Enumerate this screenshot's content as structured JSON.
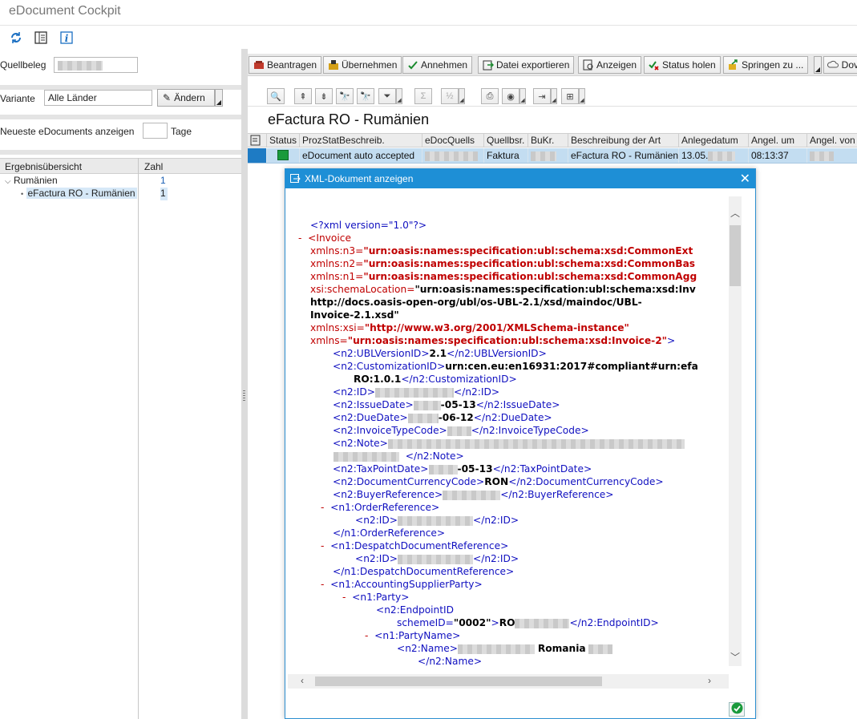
{
  "window": {
    "title": "eDocument Cockpit"
  },
  "app_toolbar": {
    "icons": [
      "refresh-icon",
      "layout-icon",
      "info-icon"
    ]
  },
  "selection": {
    "quellbeleg_label": "Quellbeleg",
    "variante_label": "Variante",
    "variante_value": "Alle Länder",
    "aendern_label": "Ändern",
    "neueste_label": "Neueste eDocuments anzeigen",
    "tage_label": "Tage"
  },
  "tree": {
    "col1": "Ergebnisübersicht",
    "col2": "Zahl",
    "rows": [
      {
        "label": "Rumänien",
        "count": "1"
      },
      {
        "label": "eFactura RO - Rumänien",
        "count": "1"
      }
    ]
  },
  "toolbar": {
    "beantragen": "Beantragen",
    "uebernehmen": "Übernehmen",
    "annehmen": "Annehmen",
    "datei_exportieren": "Datei exportieren",
    "anzeigen": "Anzeigen",
    "status_holen": "Status holen",
    "springen_zu": "Springen zu ...",
    "dov": "Dov"
  },
  "grid": {
    "title": "eFactura RO - Rumänien",
    "columns": [
      "Status",
      "ProzStatBeschreib.",
      "eDocQuells",
      "Quellbsr.",
      "BuKr.",
      "Beschreibung der Art",
      "Anlegedatum",
      "Angel. um",
      "Angel. von"
    ],
    "row": {
      "status_color": "#1a9a3c",
      "prozstat": "eDocument auto accepted",
      "quellbsr": "Faktura",
      "beschreibung": "eFactura RO - Rumänien",
      "anlegedatum": "13.05.",
      "angel_um": "08:13:37"
    }
  },
  "dialog": {
    "title": "XML-Dokument anzeigen",
    "close": "✕",
    "xml": {
      "decl": "<?xml version=\"1.0\"?>",
      "invoice_open": "<Invoice",
      "ns3_attr": "xmlns:n3=",
      "ns3_val": "\"urn:oasis:names:specification:ubl:schema:xsd:CommonExt",
      "ns2_attr": "xmlns:n2=",
      "ns2_val": "\"urn:oasis:names:specification:ubl:schema:xsd:CommonBas",
      "ns1_attr": "xmlns:n1=",
      "ns1_val": "\"urn:oasis:names:specification:ubl:schema:xsd:CommonAgg",
      "schemaloc_attr": "xsi:schemaLocation=",
      "schemaloc_val1": "\"urn:oasis:names:specification:ubl:schema:xsd:Inv",
      "schemaloc_val2": "http://docs.oasis-open-org/ubl/os-UBL-2.1/xsd/maindoc/UBL-",
      "schemaloc_val3": "Invoice-2.1.xsd\"",
      "xsi_attr": "xmlns:xsi=",
      "xsi_val": "\"http://www.w3.org/2001/XMLSchema-instance\"",
      "xmlns_attr": "xmlns=",
      "xmlns_val": "\"urn:oasis:names:specification:ubl:schema:xsd:Invoice-2\"",
      "xmlns_close": ">",
      "ubl_open": "<n2:UBLVersionID>",
      "ubl_val": "2.1",
      "ubl_close": "</n2:UBLVersionID>",
      "cust_open": "<n2:CustomizationID>",
      "cust_val1": "urn:cen.eu:en16931:2017#compliant#urn:efa",
      "cust_val2": "RO:1.0.1",
      "cust_close": "</n2:CustomizationID>",
      "id_open": "<n2:ID>",
      "id_close": "</n2:ID>",
      "issue_open": "<n2:IssueDate>",
      "issue_val": "-05-13",
      "issue_close": "</n2:IssueDate>",
      "due_open": "<n2:DueDate>",
      "due_val": "-06-12",
      "due_close": "</n2:DueDate>",
      "itc_open": "<n2:InvoiceTypeCode>",
      "itc_close": "</n2:InvoiceTypeCode>",
      "note_open": "<n2:Note>",
      "note_close": "</n2:Note>",
      "tpd_open": "<n2:TaxPointDate>",
      "tpd_val": "-05-13",
      "tpd_close": "</n2:TaxPointDate>",
      "dcc_open": "<n2:DocumentCurrencyCode>",
      "dcc_val": "RON",
      "dcc_close": "</n2:DocumentCurrencyCode>",
      "buyer_open": "<n2:BuyerReference>",
      "buyer_close": "</n2:BuyerReference>",
      "order_open": "<n1:OrderReference>",
      "order_close": "</n1:OrderReference>",
      "despatch_open": "<n1:DespatchDocumentReference>",
      "despatch_close": "</n1:DespatchDocumentReference>",
      "asp_open": "<n1:AccountingSupplierParty>",
      "party_open": "<n1:Party>",
      "endpoint_open": "<n2:EndpointID",
      "scheme_attr": "schemeID=",
      "scheme_val": "\"0002\"",
      "endpoint_gt": ">",
      "endpoint_val": "RO",
      "endpoint_close": "</n2:EndpointID>",
      "partyname_open": "<n1:PartyName>",
      "name_open": "<n2:Name>",
      "name_val": "Romania",
      "name_close": "</n2:Name>",
      "minus": "-"
    }
  }
}
